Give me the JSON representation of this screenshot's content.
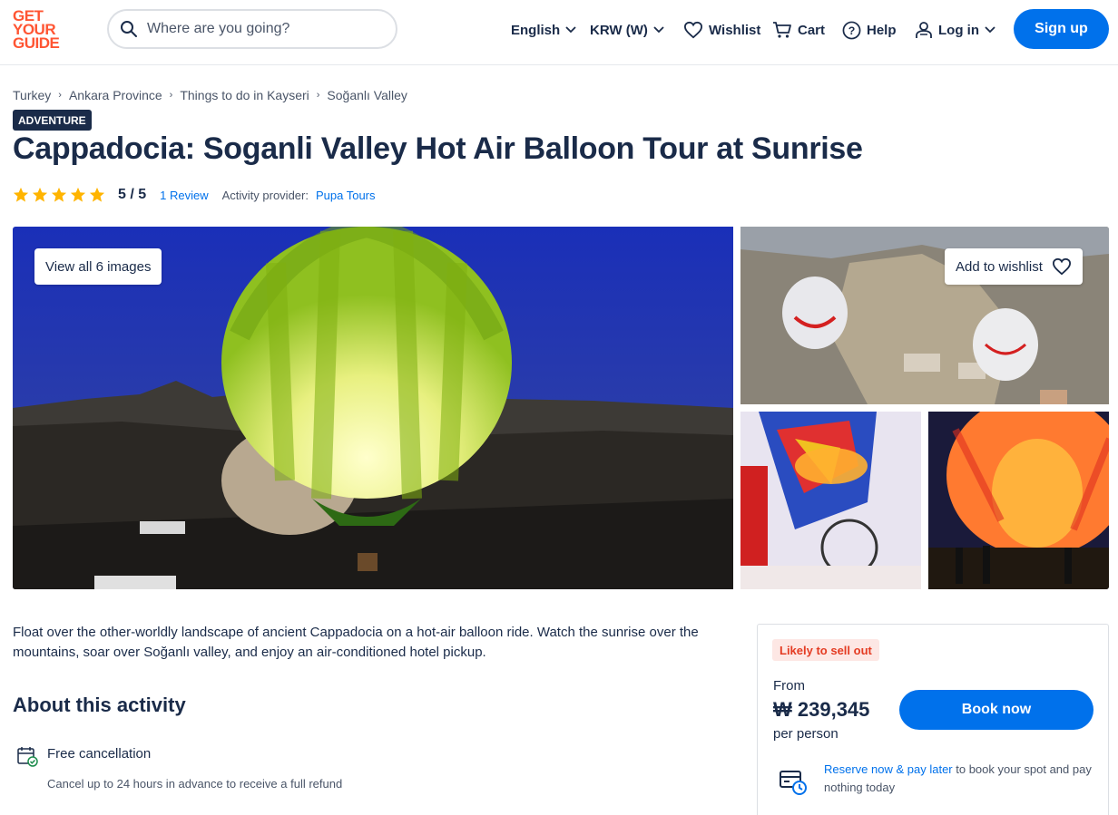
{
  "header": {
    "logo": [
      "GET",
      "YOUR",
      "GUIDE"
    ],
    "search_placeholder": "Where are you going?",
    "language": "English",
    "currency": "KRW (W)",
    "wishlist": "Wishlist",
    "cart": "Cart",
    "help": "Help",
    "login": "Log in",
    "signup": "Sign up"
  },
  "breadcrumb": [
    "Turkey",
    "Ankara Province",
    "Things to do in Kayseri",
    "Soğanlı Valley"
  ],
  "tag": "ADVENTURE",
  "title": "Cappadocia: Soganli Valley Hot Air Balloon Tour at Sunrise",
  "rating": {
    "stars": 5,
    "score": "5 / 5",
    "reviews": "1 Review",
    "provider_label": "Activity provider:",
    "provider": "Pupa Tours"
  },
  "gallery": {
    "view_all": "View all 6 images",
    "add_wishlist": "Add to wishlist"
  },
  "description": "Float over the other-worldly landscape of ancient Cappadocia on a hot-air balloon ride. Watch the sunrise over the mountains, soar over Soğanlı valley, and enjoy an air-conditioned hotel pickup.",
  "about": {
    "heading": "About this activity",
    "free_cancellation": "Free cancellation",
    "free_cancellation_sub": "Cancel up to 24 hours in advance to receive a full refund"
  },
  "booking": {
    "badge": "Likely to sell out",
    "from": "From",
    "price": "₩ 239,345",
    "per_person": "per person",
    "book_now": "Book now",
    "reserve_link": "Reserve now & pay later",
    "reserve_text": " to book your spot and pay nothing today"
  },
  "colors": {
    "brand_orange": "#ff5533",
    "primary_blue": "#0071eb",
    "navy": "#1a2b49",
    "star_yellow": "#ffb400",
    "badge_red": "#e43b22"
  }
}
